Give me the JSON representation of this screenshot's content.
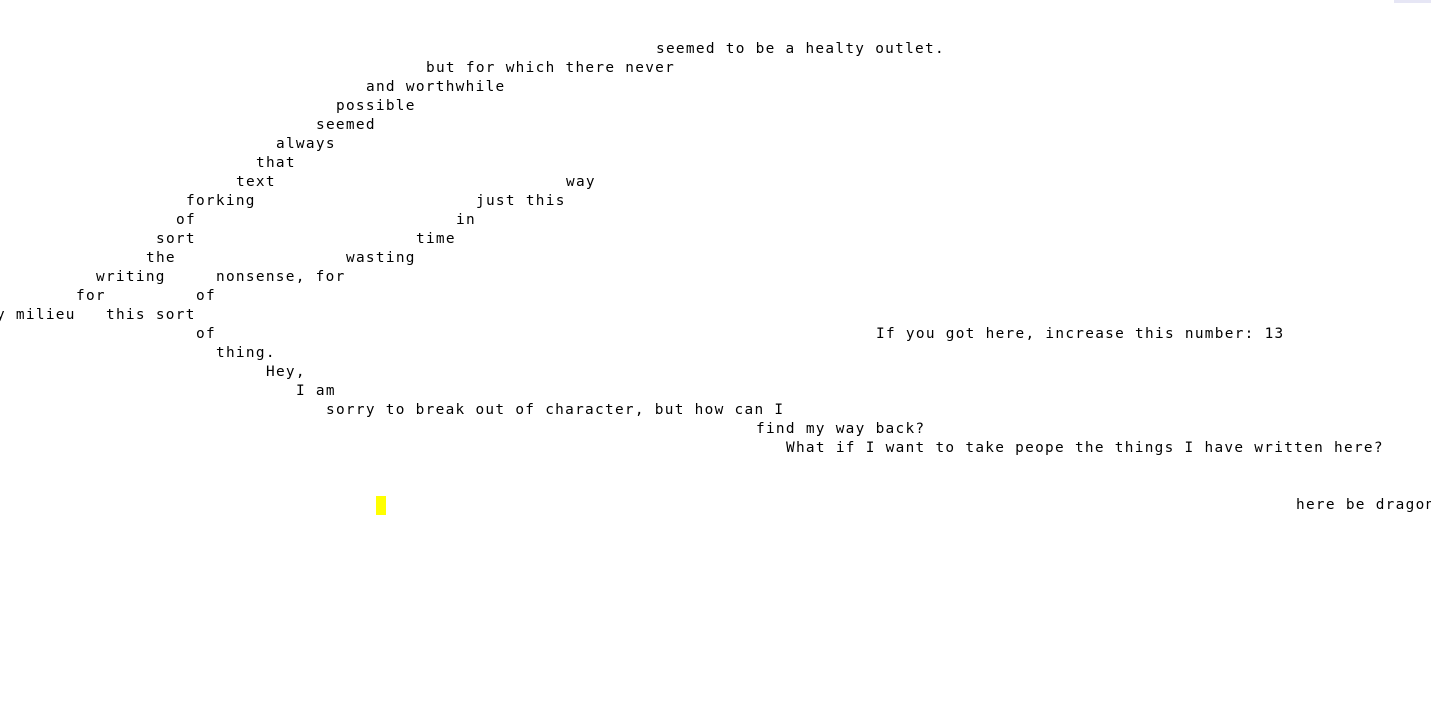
{
  "colors": {
    "background": "#ffffff",
    "text": "#000000",
    "cursor": "#ffff00",
    "corner_tab": "#e6e6f5"
  },
  "lines": {
    "l01": "seemed to be a healty outlet.",
    "l02": "but for which there never",
    "l03": "and worthwhile",
    "l04": "possible",
    "l05": "seemed",
    "l06": "always",
    "l07": "that",
    "l08": "text",
    "l09": "way",
    "l10": "forking",
    "l11": "just this",
    "l12": "of",
    "l13": "in",
    "l14": "sort",
    "l15": "time",
    "l16": "the",
    "l17": "wasting",
    "l18": "writing",
    "l19": "nonsense, for",
    "l20": "for",
    "l21": "of",
    "l22": "y milieu",
    "l23": "this sort",
    "l24": "of",
    "l25": "If you got here, increase this number: 13",
    "l26": "thing.",
    "l27": "Hey,",
    "l28": "I am",
    "l29": "sorry to break out of character, but how can I",
    "l30": "find my way back?",
    "l31": "What if I want to take peope the things I have written here?",
    "l32": "here be dragons"
  },
  "cursor": {
    "icon": "text-cursor-block"
  }
}
